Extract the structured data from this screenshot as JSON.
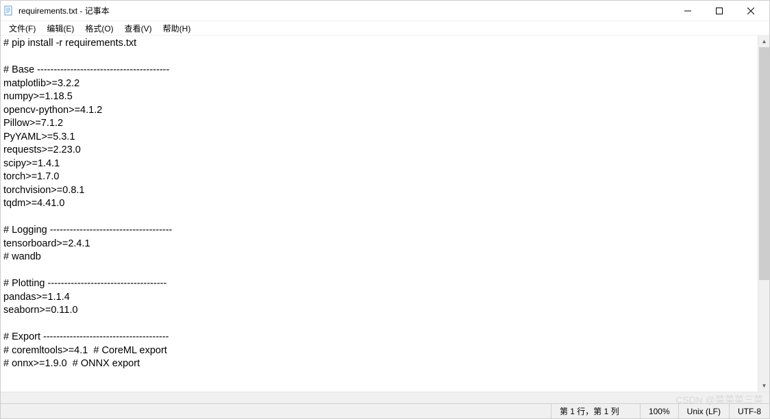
{
  "titlebar": {
    "title": "requirements.txt - 记事本"
  },
  "menubar": {
    "items": [
      "文件(F)",
      "编辑(E)",
      "格式(O)",
      "查看(V)",
      "帮助(H)"
    ]
  },
  "content": {
    "text": "# pip install -r requirements.txt\n\n# Base ----------------------------------------\nmatplotlib>=3.2.2\nnumpy>=1.18.5\nopencv-python>=4.1.2\nPillow>=7.1.2\nPyYAML>=5.3.1\nrequests>=2.23.0\nscipy>=1.4.1\ntorch>=1.7.0\ntorchvision>=0.8.1\ntqdm>=4.41.0\n\n# Logging -------------------------------------\ntensorboard>=2.4.1\n# wandb\n\n# Plotting ------------------------------------\npandas>=1.1.4\nseaborn>=0.11.0\n\n# Export --------------------------------------\n# coremltools>=4.1  # CoreML export\n# onnx>=1.9.0  # ONNX export"
  },
  "statusbar": {
    "position": "第 1 行，第 1 列",
    "zoom": "100%",
    "line_ending": "Unix (LF)",
    "encoding": "UTF-8"
  },
  "watermark": "CSDN @菜菜菜三菜"
}
